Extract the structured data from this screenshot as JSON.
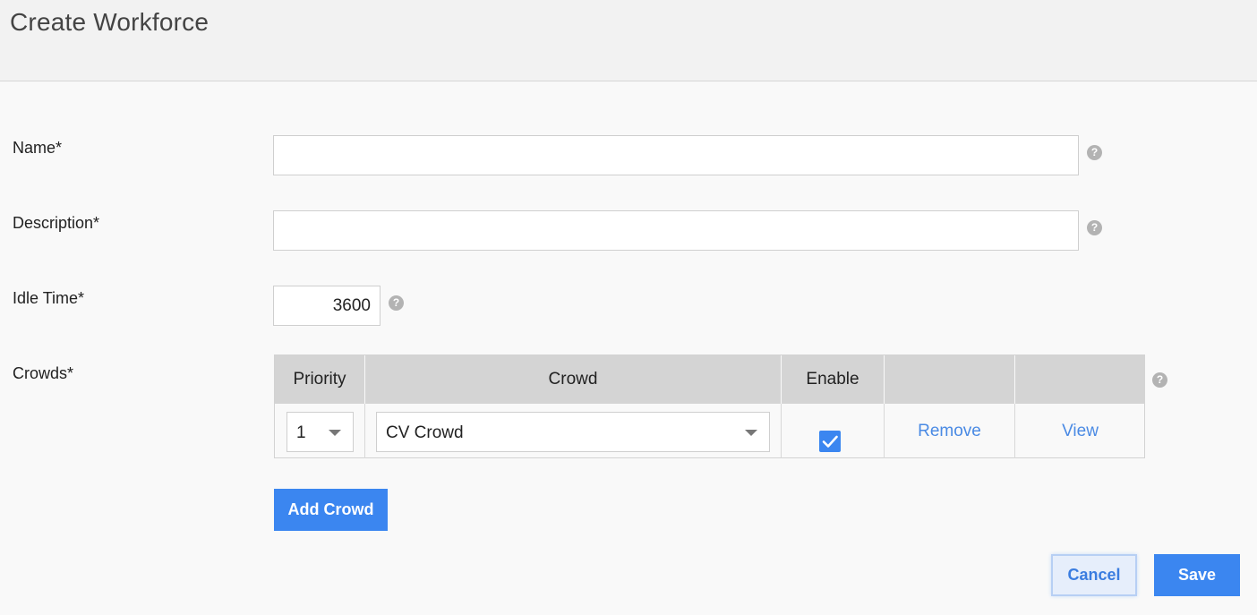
{
  "header": {
    "title": "Create Workforce"
  },
  "form": {
    "name": {
      "label": "Name*",
      "value": "",
      "help": "?"
    },
    "description": {
      "label": "Description*",
      "value": "",
      "help": "?"
    },
    "idle_time": {
      "label": "Idle Time*",
      "value": "3600",
      "help": "?"
    },
    "crowds": {
      "label": "Crowds*",
      "help": "?",
      "columns": [
        "Priority",
        "Crowd",
        "Enable",
        "",
        ""
      ],
      "rows": [
        {
          "priority": "1",
          "crowd": "CV Crowd",
          "enabled": true,
          "remove_label": "Remove",
          "view_label": "View"
        }
      ],
      "add_label": "Add Crowd"
    }
  },
  "actions": {
    "cancel_label": "Cancel",
    "save_label": "Save"
  },
  "colors": {
    "accent": "#3b86f0",
    "link": "#4a8ae4",
    "header_bg": "#f2f2f2"
  }
}
